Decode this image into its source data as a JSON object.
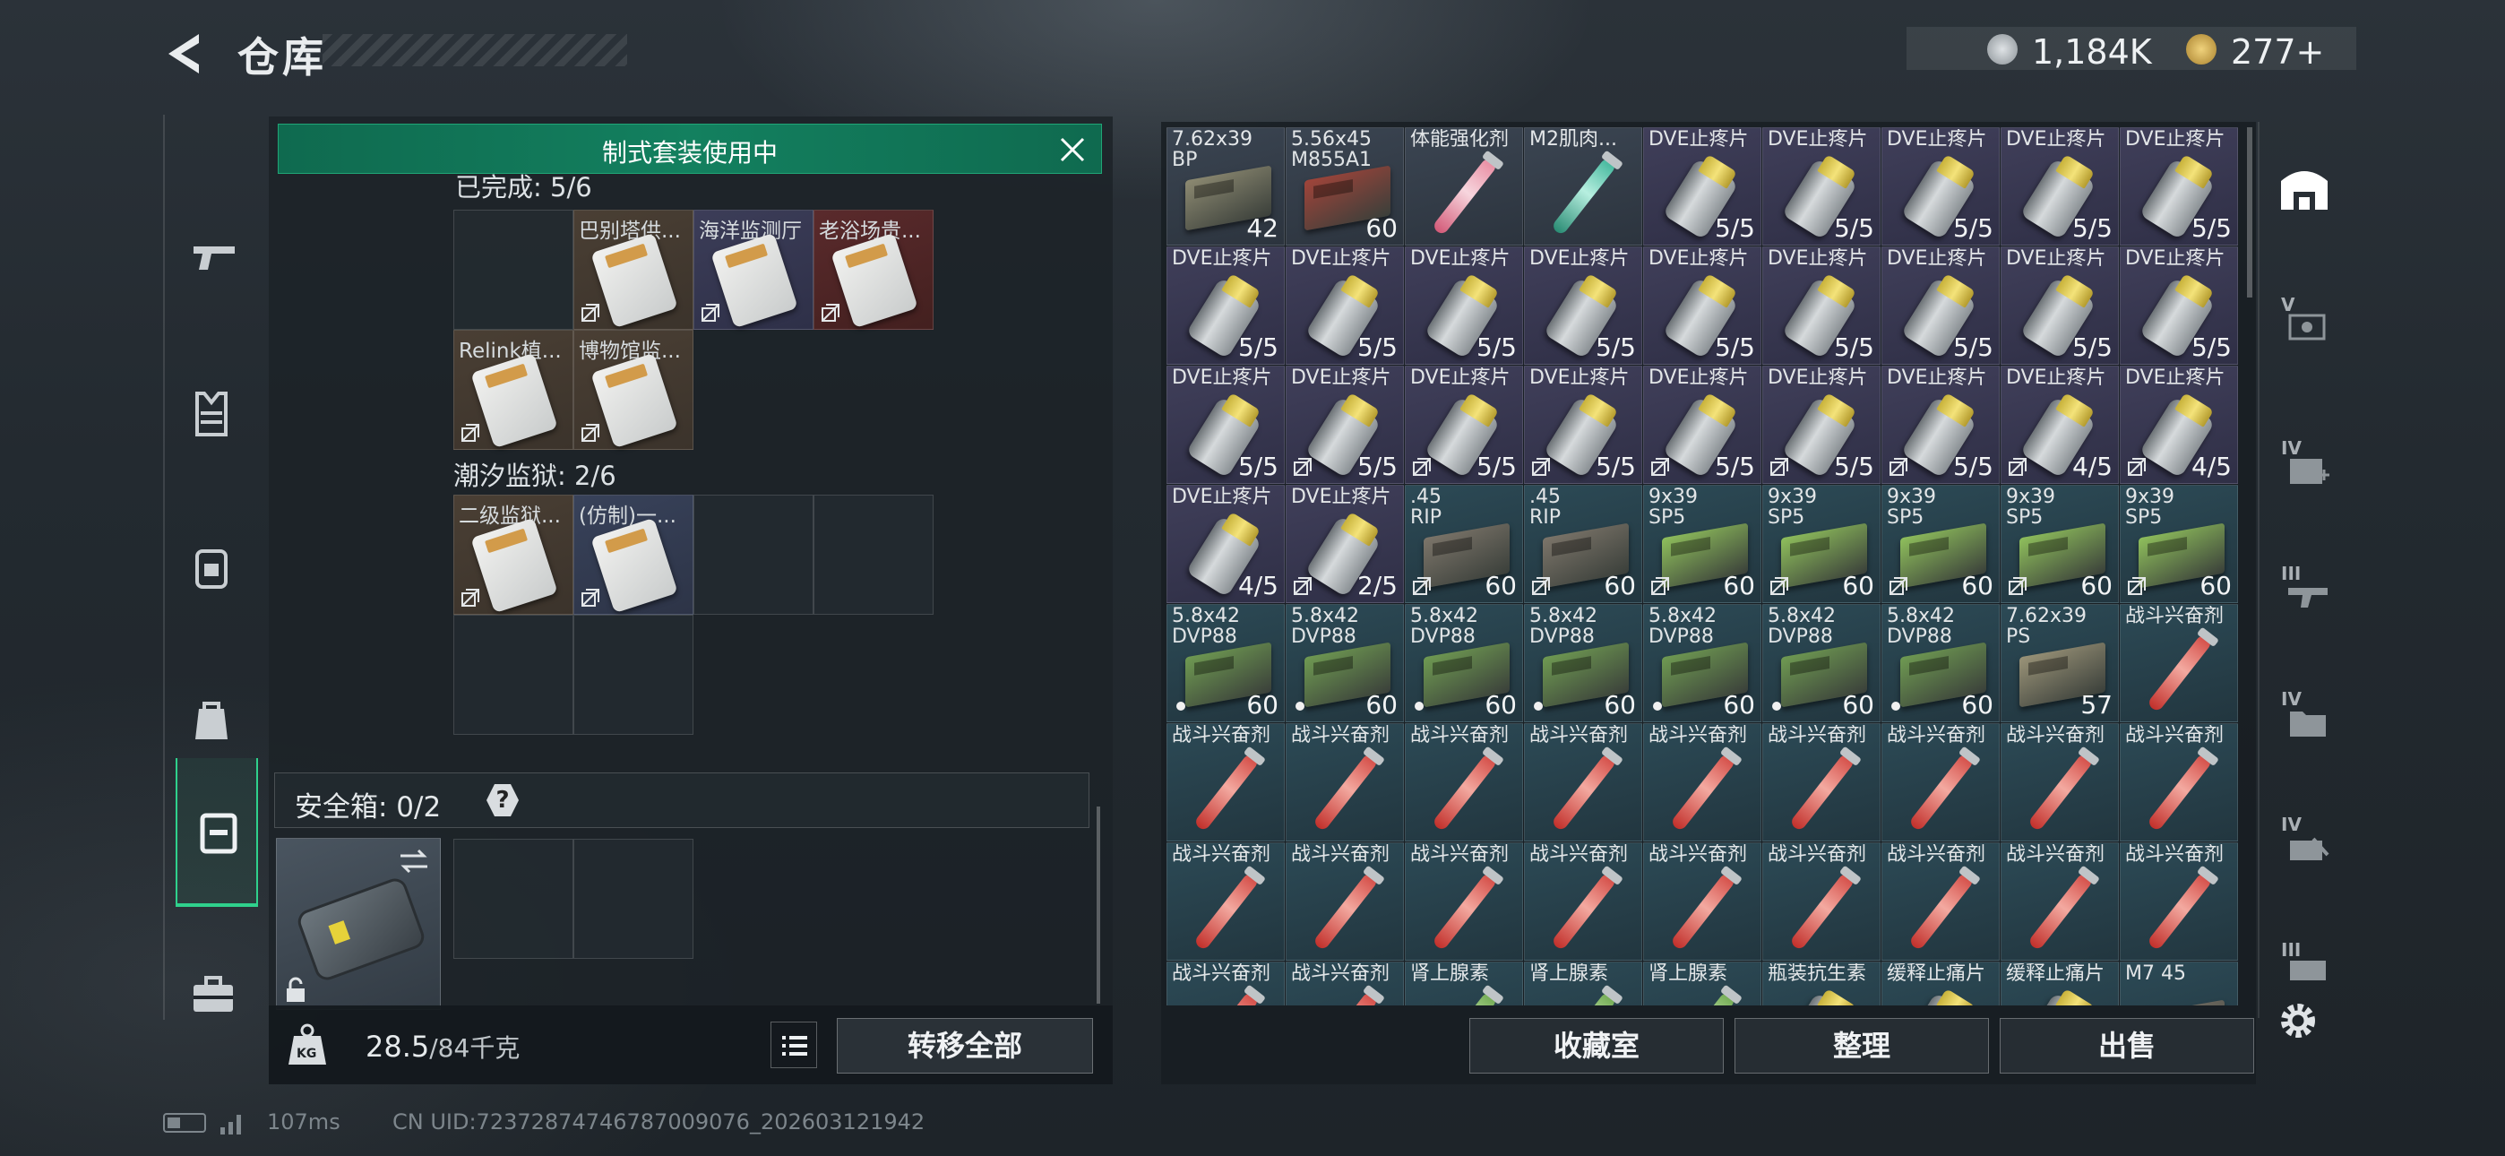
{
  "header": {
    "title": "仓库",
    "currency_a": "1,184K",
    "currency_b": "277+"
  },
  "loadout": {
    "banner": "制式套装使用中",
    "set1_label": "已完成: 5/6",
    "set1_slots": [
      {
        "name": "",
        "tone": "empty"
      },
      {
        "name": "巴别塔供...",
        "tone": "brown"
      },
      {
        "name": "海洋监测厅",
        "tone": "purple"
      },
      {
        "name": "老浴场贵...",
        "tone": "red"
      },
      {
        "name": "Relink植...",
        "tone": "brown"
      },
      {
        "name": "博物馆监...",
        "tone": "brown"
      }
    ],
    "set2_label": "潮汐监狱: 2/6",
    "set2_slots": [
      {
        "name": "二级监狱...",
        "tone": "brown"
      },
      {
        "name": "(仿制)一...",
        "tone": "blue"
      }
    ],
    "safe_label": "安全箱: 0/2",
    "help": "?",
    "weight_current": "28.5",
    "weight_max": "/84千克",
    "transfer_all": "转移全部"
  },
  "storage": {
    "items": [
      {
        "name": "7.62x39",
        "name2": "BP",
        "count": "42",
        "art": "ammo",
        "color": "#8d8a72"
      },
      {
        "name": "5.56x45",
        "name2": "M855A1",
        "count": "60",
        "art": "ammo",
        "color": "#a0443a"
      },
      {
        "name": "体能强化剂",
        "count": "",
        "art": "syr-pink"
      },
      {
        "name": "M2肌肉...",
        "count": "",
        "art": "syr-teal"
      },
      {
        "name": "DVE止疼片",
        "count": "5/5",
        "art": "pill"
      },
      {
        "name": "DVE止疼片",
        "count": "5/5",
        "art": "pill"
      },
      {
        "name": "DVE止疼片",
        "count": "5/5",
        "art": "pill"
      },
      {
        "name": "DVE止疼片",
        "count": "5/5",
        "art": "pill"
      },
      {
        "name": "DVE止疼片",
        "count": "5/5",
        "art": "pill"
      },
      {
        "name": "DVE止疼片",
        "count": "5/5",
        "art": "pill"
      },
      {
        "name": "DVE止疼片",
        "count": "5/5",
        "art": "pill"
      },
      {
        "name": "DVE止疼片",
        "count": "5/5",
        "art": "pill"
      },
      {
        "name": "DVE止疼片",
        "count": "5/5",
        "art": "pill"
      },
      {
        "name": "DVE止疼片",
        "count": "5/5",
        "art": "pill"
      },
      {
        "name": "DVE止疼片",
        "count": "5/5",
        "art": "pill"
      },
      {
        "name": "DVE止疼片",
        "count": "5/5",
        "art": "pill"
      },
      {
        "name": "DVE止疼片",
        "count": "5/5",
        "art": "pill"
      },
      {
        "name": "DVE止疼片",
        "count": "5/5",
        "art": "pill"
      },
      {
        "name": "DVE止疼片",
        "count": "5/5",
        "art": "pill"
      },
      {
        "name": "DVE止疼片",
        "count": "5/5",
        "art": "pill",
        "lock": true
      },
      {
        "name": "DVE止疼片",
        "count": "5/5",
        "art": "pill",
        "lock": true
      },
      {
        "name": "DVE止疼片",
        "count": "5/5",
        "art": "pill",
        "lock": true
      },
      {
        "name": "DVE止疼片",
        "count": "5/5",
        "art": "pill",
        "lock": true
      },
      {
        "name": "DVE止疼片",
        "count": "5/5",
        "art": "pill",
        "lock": true
      },
      {
        "name": "DVE止疼片",
        "count": "5/5",
        "art": "pill",
        "lock": true
      },
      {
        "name": "DVE止疼片",
        "count": "4/5",
        "art": "pill",
        "lock": true
      },
      {
        "name": "DVE止疼片",
        "count": "4/5",
        "art": "pill",
        "lock": true
      },
      {
        "name": "DVE止疼片",
        "count": "4/5",
        "art": "pill"
      },
      {
        "name": "DVE止疼片",
        "count": "2/5",
        "art": "pill",
        "lock": true
      },
      {
        "name": ".45",
        "name2": "RIP",
        "count": "60",
        "art": "ammo",
        "color": "#7c756a",
        "tone": "teal",
        "lock": true
      },
      {
        "name": ".45",
        "name2": "RIP",
        "count": "60",
        "art": "ammo",
        "color": "#7c756a",
        "tone": "teal",
        "lock": true
      },
      {
        "name": "9x39",
        "name2": "SP5",
        "count": "60",
        "art": "ammo",
        "color": "#8fbf5c",
        "tone": "teal",
        "lock": true
      },
      {
        "name": "9x39",
        "name2": "SP5",
        "count": "60",
        "art": "ammo",
        "color": "#8fbf5c",
        "tone": "teal",
        "lock": true
      },
      {
        "name": "9x39",
        "name2": "SP5",
        "count": "60",
        "art": "ammo",
        "color": "#8fbf5c",
        "tone": "teal",
        "lock": true
      },
      {
        "name": "9x39",
        "name2": "SP5",
        "count": "60",
        "art": "ammo",
        "color": "#8fbf5c",
        "tone": "teal",
        "lock": true
      },
      {
        "name": "9x39",
        "name2": "SP5",
        "count": "60",
        "art": "ammo",
        "color": "#8fbf5c",
        "tone": "teal",
        "lock": true
      },
      {
        "name": "5.8x42",
        "name2": "DVP88",
        "count": "60",
        "art": "ammo",
        "color": "#6f9a52",
        "tone": "teal",
        "dot": true
      },
      {
        "name": "5.8x42",
        "name2": "DVP88",
        "count": "60",
        "art": "ammo",
        "color": "#6f9a52",
        "tone": "teal",
        "dot": true
      },
      {
        "name": "5.8x42",
        "name2": "DVP88",
        "count": "60",
        "art": "ammo",
        "color": "#6f9a52",
        "tone": "teal",
        "dot": true
      },
      {
        "name": "5.8x42",
        "name2": "DVP88",
        "count": "60",
        "art": "ammo",
        "color": "#6f9a52",
        "tone": "teal",
        "dot": true
      },
      {
        "name": "5.8x42",
        "name2": "DVP88",
        "count": "60",
        "art": "ammo",
        "color": "#6f9a52",
        "tone": "teal",
        "dot": true
      },
      {
        "name": "5.8x42",
        "name2": "DVP88",
        "count": "60",
        "art": "ammo",
        "color": "#6f9a52",
        "tone": "teal",
        "dot": true
      },
      {
        "name": "5.8x42",
        "name2": "DVP88",
        "count": "60",
        "art": "ammo",
        "color": "#6f9a52",
        "tone": "teal",
        "dot": true
      },
      {
        "name": "7.62x39",
        "name2": "PS",
        "count": "57",
        "art": "ammo",
        "color": "#9a9378",
        "tone": "teal"
      },
      {
        "name": "战斗兴奋剂",
        "count": "",
        "art": "syr",
        "tone": "teal"
      },
      {
        "name": "战斗兴奋剂",
        "count": "",
        "art": "syr",
        "tone": "teal"
      },
      {
        "name": "战斗兴奋剂",
        "count": "",
        "art": "syr",
        "tone": "teal"
      },
      {
        "name": "战斗兴奋剂",
        "count": "",
        "art": "syr",
        "tone": "teal"
      },
      {
        "name": "战斗兴奋剂",
        "count": "",
        "art": "syr",
        "tone": "teal"
      },
      {
        "name": "战斗兴奋剂",
        "count": "",
        "art": "syr",
        "tone": "teal"
      },
      {
        "name": "战斗兴奋剂",
        "count": "",
        "art": "syr",
        "tone": "teal"
      },
      {
        "name": "战斗兴奋剂",
        "count": "",
        "art": "syr",
        "tone": "teal"
      },
      {
        "name": "战斗兴奋剂",
        "count": "",
        "art": "syr",
        "tone": "teal"
      },
      {
        "name": "战斗兴奋剂",
        "count": "",
        "art": "syr",
        "tone": "teal"
      },
      {
        "name": "战斗兴奋剂",
        "count": "",
        "art": "syr",
        "tone": "teal"
      },
      {
        "name": "战斗兴奋剂",
        "count": "",
        "art": "syr",
        "tone": "teal"
      },
      {
        "name": "战斗兴奋剂",
        "count": "",
        "art": "syr",
        "tone": "teal"
      },
      {
        "name": "战斗兴奋剂",
        "count": "",
        "art": "syr",
        "tone": "teal"
      },
      {
        "name": "战斗兴奋剂",
        "count": "",
        "art": "syr",
        "tone": "teal"
      },
      {
        "name": "战斗兴奋剂",
        "count": "",
        "art": "syr",
        "tone": "teal"
      },
      {
        "name": "战斗兴奋剂",
        "count": "",
        "art": "syr",
        "tone": "teal"
      },
      {
        "name": "战斗兴奋剂",
        "count": "",
        "art": "syr",
        "tone": "teal"
      },
      {
        "name": "战斗兴奋剂",
        "count": "",
        "art": "syr",
        "tone": "teal"
      },
      {
        "name": "战斗兴奋剂",
        "count": "",
        "art": "syr",
        "tone": "teal"
      },
      {
        "name": "战斗兴奋剂",
        "count": "",
        "art": "syr",
        "tone": "teal"
      },
      {
        "name": "肾上腺素",
        "count": "",
        "art": "syr-green",
        "tone": "teal"
      },
      {
        "name": "肾上腺素",
        "count": "",
        "art": "syr-green",
        "tone": "teal"
      },
      {
        "name": "肾上腺素",
        "count": "",
        "art": "syr-green",
        "tone": "teal"
      },
      {
        "name": "瓶装抗生素",
        "count": "",
        "art": "pill",
        "tone": "teal"
      },
      {
        "name": "缓释止痛片",
        "count": "",
        "art": "pill",
        "tone": "teal"
      },
      {
        "name": "缓释止痛片",
        "count": "",
        "art": "pill",
        "tone": "teal"
      },
      {
        "name": "M7 45",
        "count": "",
        "art": "ammo",
        "color": "#7c756a",
        "tone": "teal"
      }
    ]
  },
  "footer": {
    "collection": "收藏室",
    "organize": "整理",
    "sell": "出售"
  },
  "status": {
    "ping": "107ms",
    "uid": "CN UID:72372874746787009076_202603121942"
  },
  "colors": {
    "banner": "#13805f",
    "accent_green": "#2fd18c"
  }
}
